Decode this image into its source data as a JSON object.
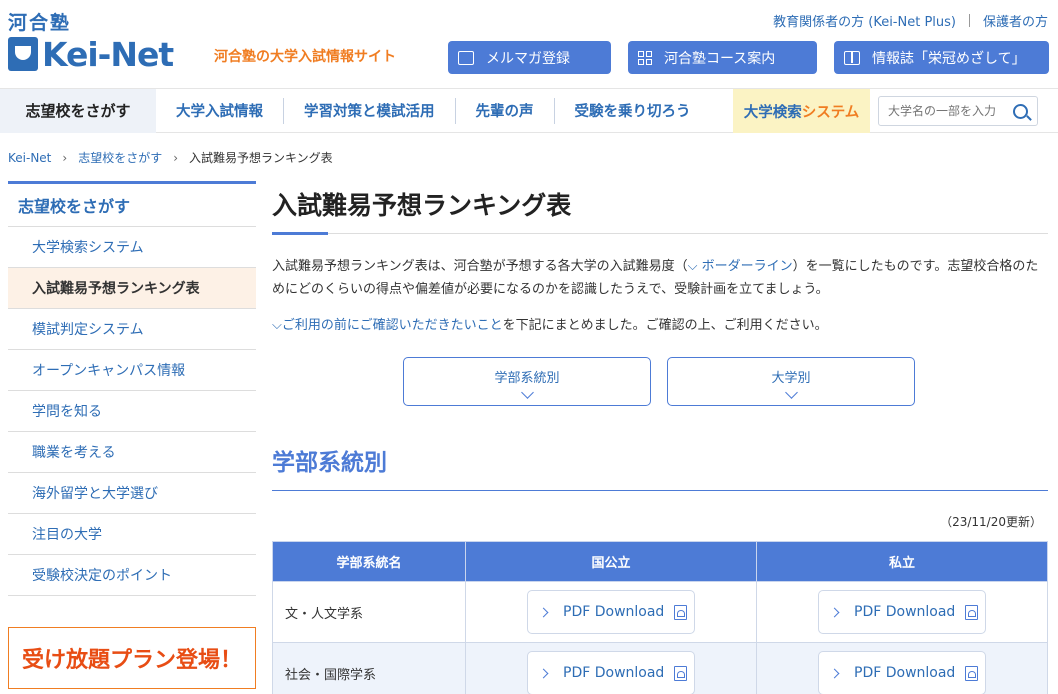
{
  "header": {
    "kawai_logo": "河合塾",
    "brand_logo": "Kei-Net",
    "tagline": "河合塾の大学入試情報サイト",
    "top_links": [
      "教育関係者の方 (Kei-Net Plus)",
      "保護者の方"
    ],
    "buttons": [
      {
        "label": "メルマガ登録",
        "icon": "mail-icon"
      },
      {
        "label": "河合塾コース案内",
        "icon": "grid-icon"
      },
      {
        "label": "情報誌「栄冠めざして」",
        "icon": "book-icon"
      }
    ]
  },
  "nav": {
    "active": "志望校をさがす",
    "items": [
      "大学入試情報",
      "学習対策と模試活用",
      "先輩の声",
      "受験を乗り切ろう"
    ],
    "search_system": {
      "part1": "大学検索",
      "part2": "システム"
    },
    "search_placeholder": "大学名の一部を入力"
  },
  "breadcrumb": {
    "items": [
      "Kei-Net",
      "志望校をさがす"
    ],
    "current": "入試難易予想ランキング表"
  },
  "sidebar": {
    "heading": "志望校をさがす",
    "items": [
      "大学検索システム",
      "入試難易予想ランキング表",
      "模試判定システム",
      "オープンキャンパス情報",
      "学問を知る",
      "職業を考える",
      "海外留学と大学選び",
      "注目の大学",
      "受験校決定のポイント"
    ],
    "active_index": 1,
    "promo": "受け放題プラン登場！"
  },
  "main": {
    "title": "入試難易予想ランキング表",
    "intro_1": "入試難易予想ランキング表は、河合塾が予想する各大学の入試難易度（",
    "intro_link": "ボーダーライン",
    "intro_2": "）を一覧にしたものです。志望校合格のためにどのくらいの得点や偏差値が必要になるのかを認識したうえで、受験計画を立てましょう。",
    "note_link": "ご利用の前にご確認いただきたいこと",
    "note_rest": "を下記にまとめました。ご確認の上、ご利用ください。",
    "jump_buttons": [
      "学部系統別",
      "大学別"
    ],
    "section_title": "学部系統別",
    "updated": "（23/11/20更新）",
    "table": {
      "headers": [
        "学部系統名",
        "国公立",
        "私立"
      ],
      "rows": [
        {
          "name": "文・人文学系",
          "public": "PDF Download",
          "private": "PDF Download"
        },
        {
          "name": "社会・国際学系",
          "public": "PDF Download",
          "private": "PDF Download"
        }
      ]
    }
  }
}
